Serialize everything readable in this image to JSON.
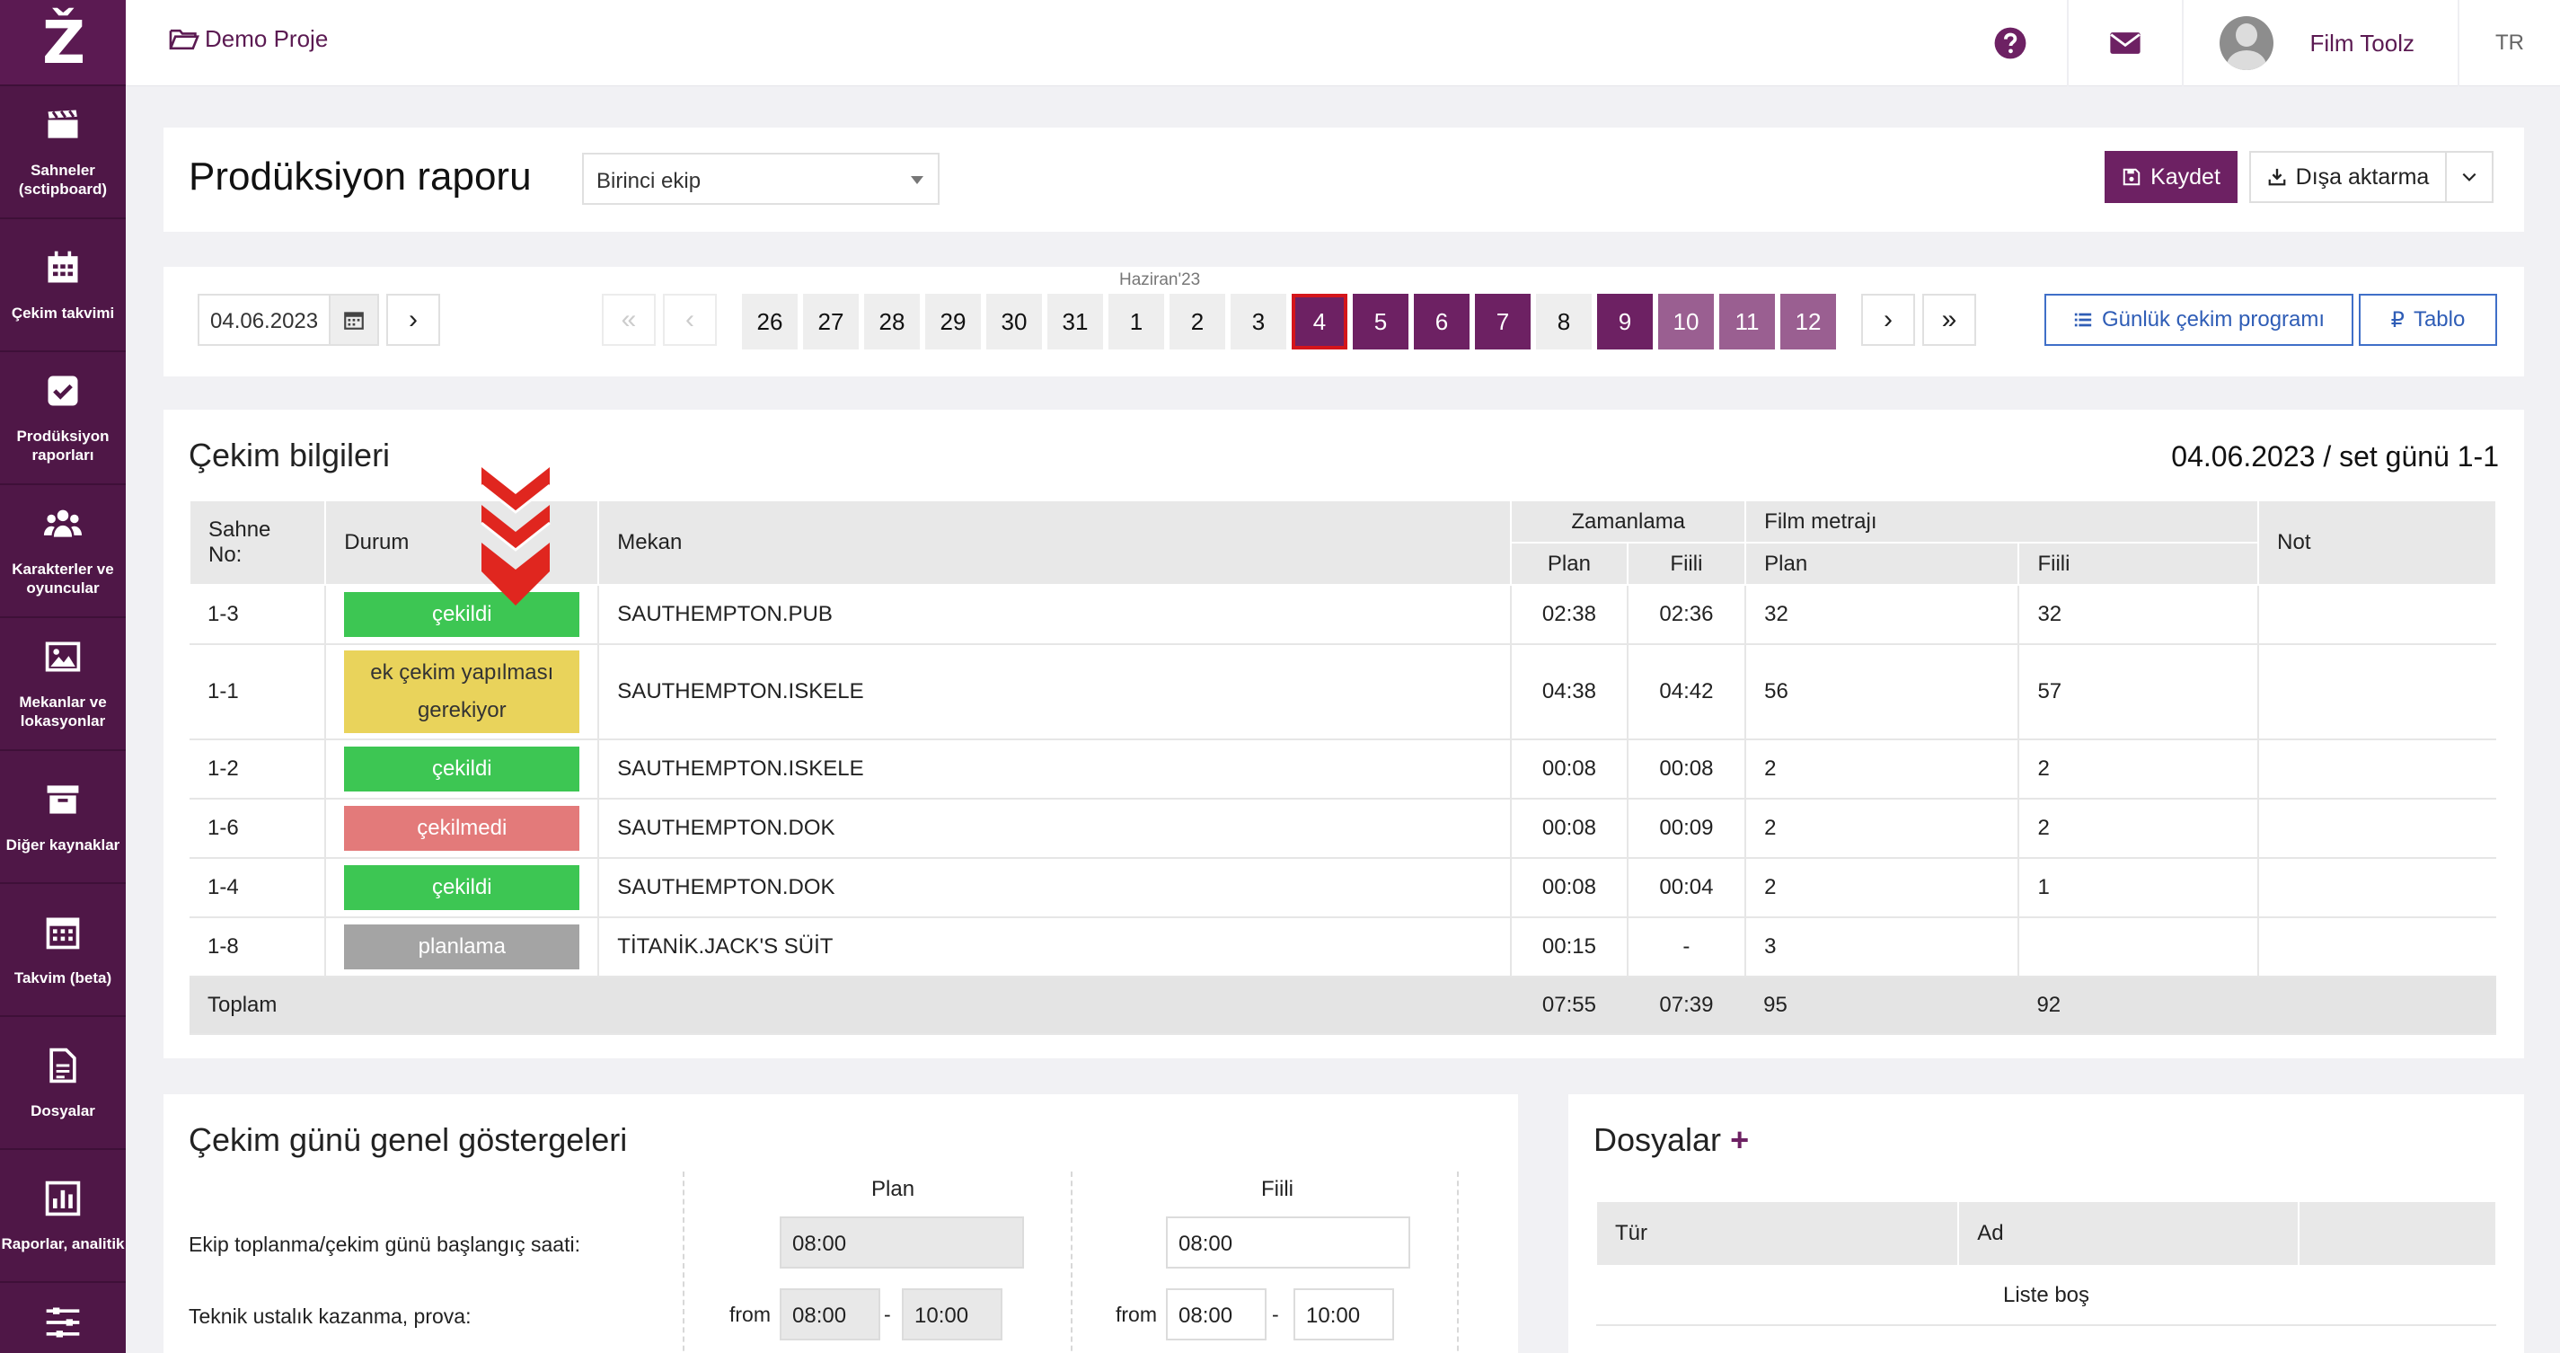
{
  "app": {
    "logo": "Ž",
    "project": "Demo Proje",
    "user": "Film Toolz",
    "lang": "TR"
  },
  "sidebar": {
    "items": [
      {
        "label": "Sahneler (sctipboard)",
        "icon": "clapperboard-icon"
      },
      {
        "label": "Çekim takvimi",
        "icon": "calendar-icon"
      },
      {
        "label": "Prodüksiyon raporları",
        "icon": "checkbox-icon"
      },
      {
        "label": "Karakterler ve oyuncular",
        "icon": "users-icon"
      },
      {
        "label": "Mekanlar ve lokasyonlar",
        "icon": "image-icon"
      },
      {
        "label": "Diğer kaynaklar",
        "icon": "archive-icon"
      },
      {
        "label": "Takvim (beta)",
        "icon": "calendar-grid-icon"
      },
      {
        "label": "Dosyalar",
        "icon": "file-icon"
      },
      {
        "label": "Raporlar, analitik",
        "icon": "bar-chart-icon"
      }
    ]
  },
  "header": {
    "title": "Prodüksiyon raporu",
    "crew": "Birinci ekip",
    "save": "Kaydet",
    "export": "Dışa aktarma"
  },
  "datebar": {
    "date": "04.06.2023",
    "first": "«",
    "prev": "‹",
    "next": "›",
    "last": "»",
    "next_day": "›",
    "month": "Haziran'23",
    "days": [
      "26",
      "27",
      "28",
      "29",
      "30",
      "31",
      "1",
      "2",
      "3",
      "4",
      "5",
      "6",
      "7",
      "8",
      "9",
      "10",
      "11",
      "12"
    ],
    "schedule_btn": "Günlük çekim programı",
    "table_btn": "Tablo"
  },
  "shoot": {
    "title": "Çekim bilgileri",
    "right": "04.06.2023 / set günü 1-1",
    "headers": {
      "scene": "Sahne No:",
      "status": "Durum",
      "location": "Mekan",
      "timing": "Zamanlama",
      "footage": "Film metrajı",
      "note": "Not",
      "plan": "Plan",
      "actual": "Fiili"
    },
    "rows": [
      {
        "scene": "1-3",
        "status": "çekildi",
        "location": "SAUTHEMPTON.PUB",
        "tp": "02:38",
        "ta": "02:36",
        "fp": "32",
        "fa": "32"
      },
      {
        "scene": "1-1",
        "status": "ek çekim yapılması gerekiyor",
        "location": "SAUTHEMPTON.ISKELE",
        "tp": "04:38",
        "ta": "04:42",
        "fp": "56",
        "fa": "57"
      },
      {
        "scene": "1-2",
        "status": "çekildi",
        "location": "SAUTHEMPTON.ISKELE",
        "tp": "00:08",
        "ta": "00:08",
        "fp": "2",
        "fa": "2"
      },
      {
        "scene": "1-6",
        "status": "çekilmedi",
        "location": "SAUTHEMPTON.DOK",
        "tp": "00:08",
        "ta": "00:09",
        "fp": "2",
        "fa": "2"
      },
      {
        "scene": "1-4",
        "status": "çekildi",
        "location": "SAUTHEMPTON.DOK",
        "tp": "00:08",
        "ta": "00:04",
        "fp": "2",
        "fa": "1"
      },
      {
        "scene": "1-8",
        "status": "planlama",
        "location": "TİTANİK.JACK'S SÜİT",
        "tp": "00:15",
        "ta": "-",
        "fp": "3",
        "fa": ""
      }
    ],
    "total": {
      "label": "Toplam",
      "tp": "07:55",
      "ta": "07:39",
      "fp": "95",
      "fa": "92"
    }
  },
  "indicators": {
    "title": "Çekim günü genel göstergeleri",
    "plan": "Plan",
    "actual": "Fiili",
    "row1": {
      "label": "Ekip toplanma/çekim günü başlangıç saati:",
      "plan": "08:00",
      "actual": "08:00"
    },
    "row2": {
      "label": "Teknik ustalık kazanma, prova:",
      "from": "from",
      "dash": "-",
      "plan_from": "08:00",
      "plan_to": "10:00",
      "actual_from": "08:00",
      "actual_to": "10:00"
    }
  },
  "files": {
    "title": "Dosyalar",
    "plus": "+",
    "col_type": "Tür",
    "col_name": "Ad",
    "empty": "Liste boş"
  }
}
